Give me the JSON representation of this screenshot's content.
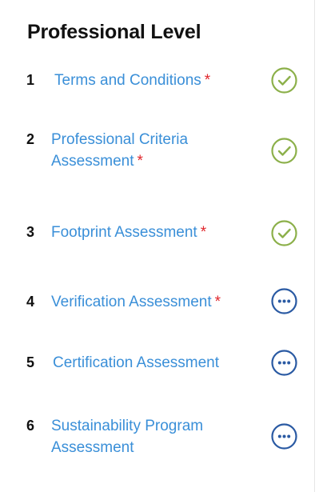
{
  "panel": {
    "title": "Professional Level"
  },
  "steps": [
    {
      "number": "1",
      "label": "Terms and Conditions",
      "required": "*",
      "status": "complete",
      "status_icon": "check-circle-icon"
    },
    {
      "number": "2",
      "label": "Professional Criteria Assessment",
      "required": "*",
      "status": "complete",
      "status_icon": "check-circle-icon"
    },
    {
      "number": "3",
      "label": "Footprint Assessment",
      "required": "*",
      "status": "complete",
      "status_icon": "check-circle-icon"
    },
    {
      "number": "4",
      "label": "Verification Assessment",
      "required": "*",
      "status": "pending",
      "status_icon": "more-circle-icon"
    },
    {
      "number": "5",
      "label": "Certification Assessment",
      "required": "",
      "status": "pending",
      "status_icon": "more-circle-icon"
    },
    {
      "number": "6",
      "label": "Sustainability Program Assessment",
      "required": "",
      "status": "pending",
      "status_icon": "more-circle-icon"
    }
  ],
  "colors": {
    "link": "#3a8fd8",
    "required": "#e0252b",
    "complete": "#8cb04a",
    "pending": "#2a5aa3"
  }
}
